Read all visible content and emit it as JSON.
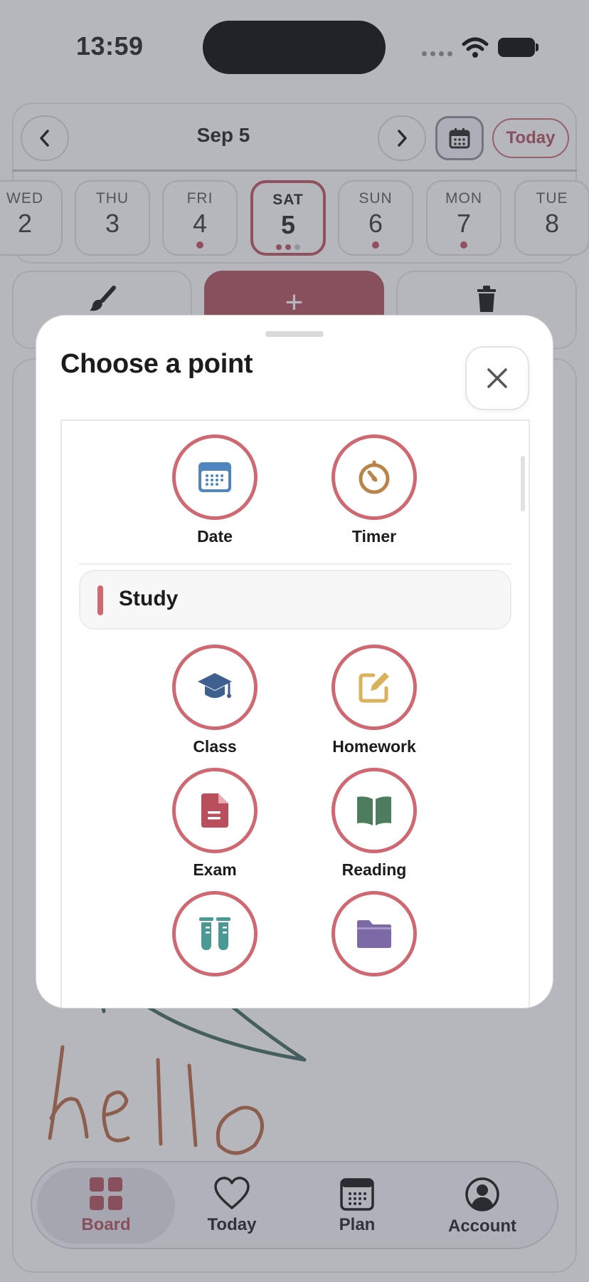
{
  "status_bar": {
    "time": "13:59"
  },
  "header": {
    "date_label": "Sep 5",
    "today_label": "Today",
    "days": [
      {
        "name": "WED",
        "num": "2"
      },
      {
        "name": "THU",
        "num": "3"
      },
      {
        "name": "FRI",
        "num": "4"
      },
      {
        "name": "SAT",
        "num": "5"
      },
      {
        "name": "SUN",
        "num": "6"
      },
      {
        "name": "MON",
        "num": "7"
      },
      {
        "name": "TUE",
        "num": "8"
      }
    ]
  },
  "actions": {
    "add_label": "+"
  },
  "canvas": {
    "handwriting": "hello"
  },
  "tabs": [
    {
      "label": "Board"
    },
    {
      "label": "Today"
    },
    {
      "label": "Plan"
    },
    {
      "label": "Account"
    }
  ],
  "modal": {
    "title": "Choose a point",
    "points_top": [
      {
        "label": "Date",
        "icon": "calendar-icon"
      },
      {
        "label": "Timer",
        "icon": "timer-icon"
      }
    ],
    "section": {
      "title": "Study"
    },
    "points_study": [
      {
        "label": "Class",
        "icon": "graduation-cap-icon"
      },
      {
        "label": "Homework",
        "icon": "pencil-square-icon"
      },
      {
        "label": "Exam",
        "icon": "document-icon"
      },
      {
        "label": "Reading",
        "icon": "book-icon"
      },
      {
        "label": "",
        "icon": "test-tubes-icon"
      },
      {
        "label": "",
        "icon": "folder-icon"
      }
    ]
  },
  "colors": {
    "accent": "#b04e58",
    "ring": "#cf6870",
    "scrim": "#50506299"
  }
}
